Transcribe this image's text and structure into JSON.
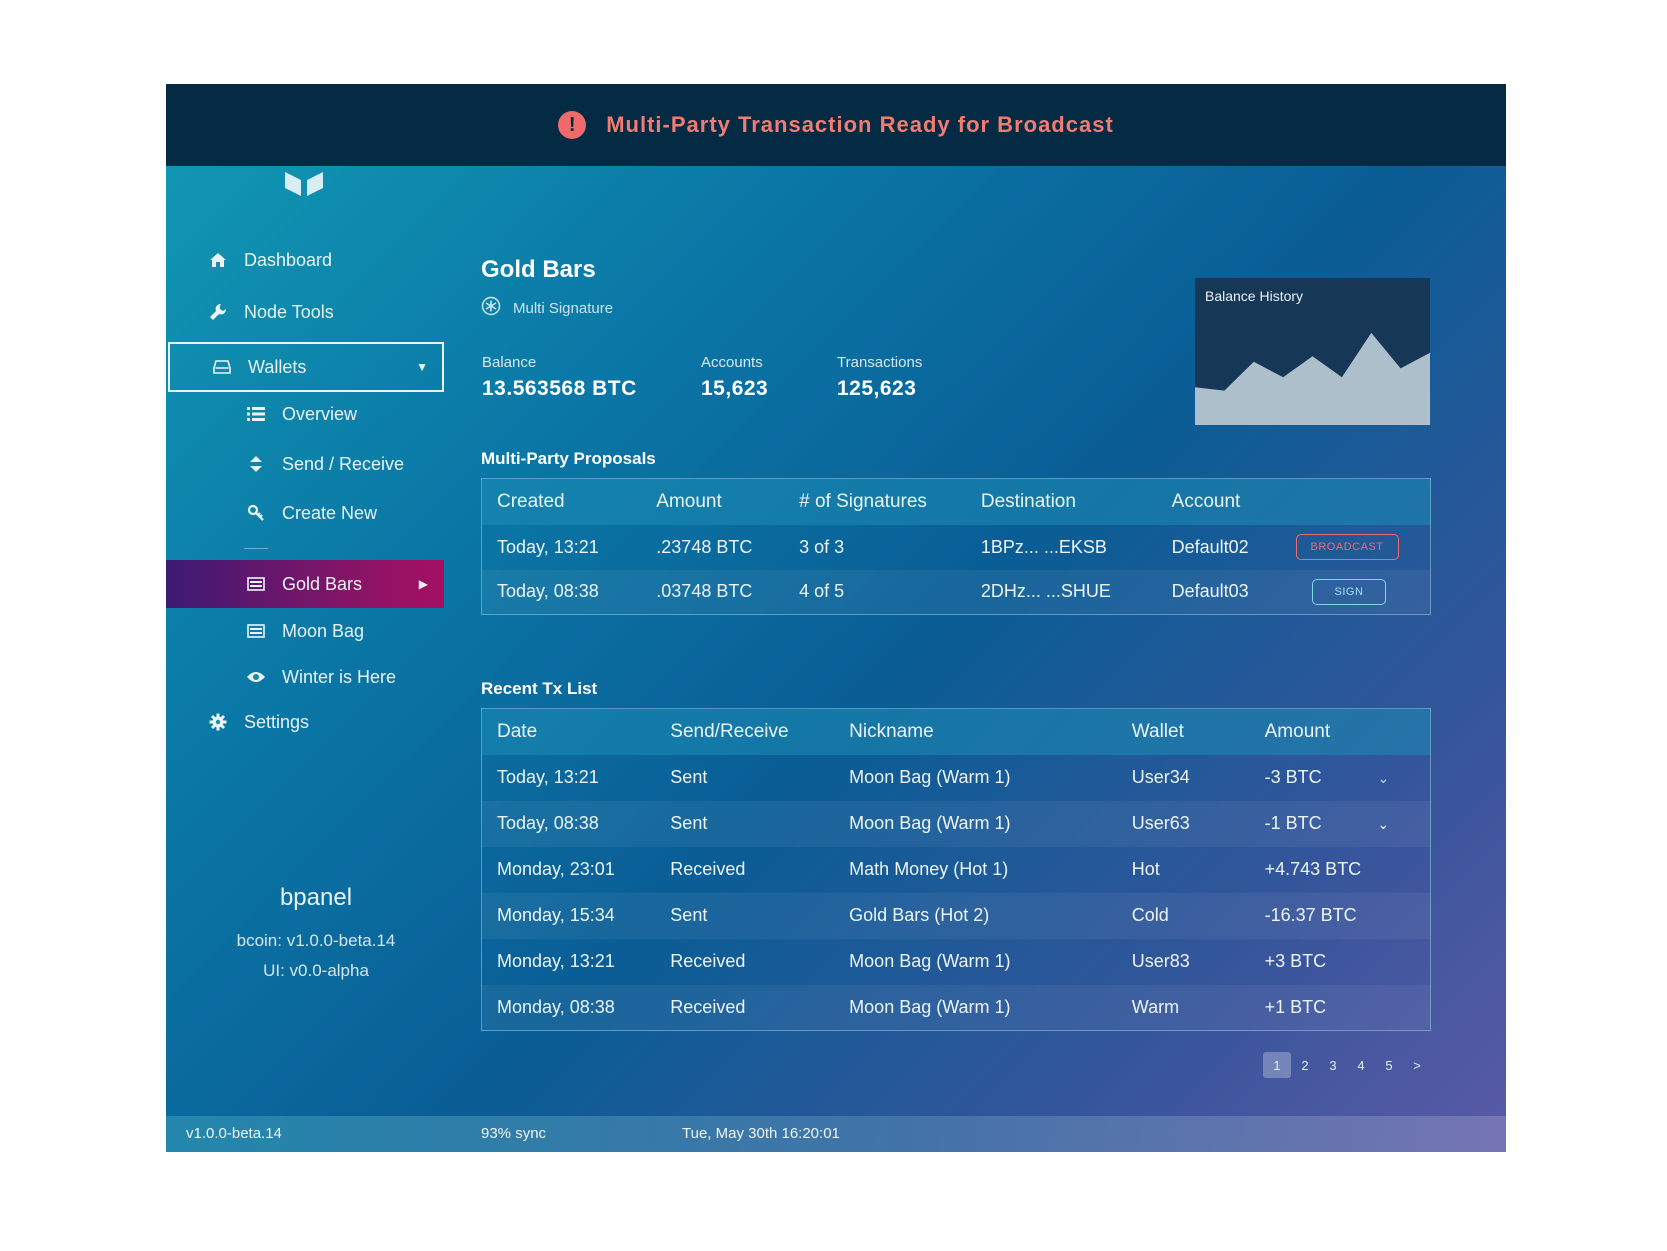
{
  "alert": {
    "icon": "exclamation-circle-icon",
    "text": "Multi-Party Transaction Ready for Broadcast",
    "color": "#f27b72"
  },
  "sidebar": {
    "items": [
      {
        "label": "Dashboard",
        "icon": "home-icon"
      },
      {
        "label": "Node Tools",
        "icon": "wrench-icon"
      },
      {
        "label": "Wallets",
        "icon": "drive-icon"
      },
      {
        "label": "Overview",
        "icon": "list-icon"
      },
      {
        "label": "Send / Receive",
        "icon": "sort-icon"
      },
      {
        "label": "Create New",
        "icon": "key-icon"
      },
      {
        "label": "Gold Bars",
        "icon": "wallet-icon"
      },
      {
        "label": "Moon Bag",
        "icon": "wallet-icon"
      },
      {
        "label": "Winter is Here",
        "icon": "eye-icon"
      },
      {
        "label": "Settings",
        "icon": "gear-icon"
      }
    ],
    "active_color": "#8a1466"
  },
  "brand": {
    "name": "bpanel",
    "bcoin_version": "bcoin: v1.0.0-beta.14",
    "ui_version": "UI: v0.0-alpha"
  },
  "wallet": {
    "title": "Gold Bars",
    "type": "Multi Signature",
    "stats": [
      {
        "label": "Balance",
        "value": "13.563568 BTC"
      },
      {
        "label": "Accounts",
        "value": "15,623"
      },
      {
        "label": "Transactions",
        "value": "125,623"
      }
    ]
  },
  "balance_history": {
    "title": "Balance History",
    "series": [
      0.34,
      0.31,
      0.57,
      0.43,
      0.62,
      0.43,
      0.83,
      0.51,
      0.65
    ]
  },
  "proposals": {
    "title": "Multi-Party Proposals",
    "headers": [
      "Created",
      "Amount",
      "# of Signatures",
      "Destination",
      "Account"
    ],
    "rows": [
      {
        "created": "Today, 13:21",
        "amount": ".23748 BTC",
        "signatures": "3 of 3",
        "destination": "1BPz...  ...EKSB",
        "account": "Default02",
        "action": "BROADCAST"
      },
      {
        "created": "Today, 08:38",
        "amount": ".03748 BTC",
        "signatures": "4 of 5",
        "destination": "2DHz...  ...SHUE",
        "account": "Default03",
        "action": "SIGN"
      }
    ]
  },
  "txlist": {
    "title": "Recent Tx List",
    "headers": [
      "Date",
      "Send/Receive",
      "Nickname",
      "Wallet",
      "Amount"
    ],
    "rows": [
      {
        "date": "Today, 13:21",
        "direction": "Sent",
        "nickname": "Moon Bag (Warm 1)",
        "wallet": "User34",
        "amount": "-3 BTC"
      },
      {
        "date": "Today, 08:38",
        "direction": "Sent",
        "nickname": "Moon Bag (Warm 1)",
        "wallet": "User63",
        "amount": "-1 BTC"
      },
      {
        "date": "Monday, 23:01",
        "direction": "Received",
        "nickname": "Math Money (Hot 1)",
        "wallet": "Hot",
        "amount": "+4.743 BTC"
      },
      {
        "date": "Monday, 15:34",
        "direction": "Sent",
        "nickname": "Gold Bars (Hot 2)",
        "wallet": "Cold",
        "amount": "-16.37 BTC"
      },
      {
        "date": "Monday, 13:21",
        "direction": "Received",
        "nickname": "Moon Bag (Warm 1)",
        "wallet": "User83",
        "amount": "+3 BTC"
      },
      {
        "date": "Monday, 08:38",
        "direction": "Received",
        "nickname": "Moon Bag (Warm 1)",
        "wallet": "Warm",
        "amount": "+1 BTC"
      }
    ]
  },
  "pagination": {
    "pages": [
      "1",
      "2",
      "3",
      "4",
      "5"
    ],
    "current": "1",
    "next": ">"
  },
  "status": {
    "version": "v1.0.0-beta.14",
    "sync": "93% sync",
    "datetime": "Tue, May 30th 16:20:01"
  }
}
